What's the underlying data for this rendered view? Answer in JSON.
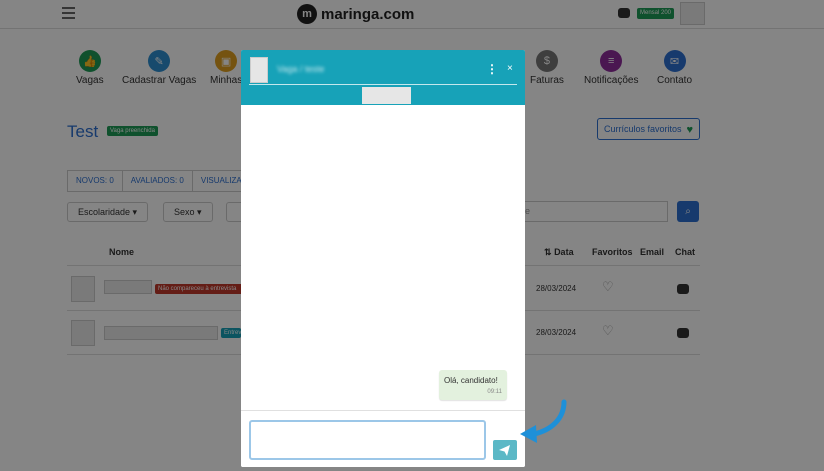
{
  "header": {
    "logo_text": "maringa.com",
    "plan_badge": "Mensal 200"
  },
  "nav": {
    "items": [
      {
        "label": "Vagas",
        "icon": "thumbs-up-icon",
        "color": "#1e9c56"
      },
      {
        "label": "Cadastrar Vagas",
        "icon": "pen-icon",
        "color": "#2c8fd1"
      },
      {
        "label": "Minhas",
        "icon": "briefcase-icon",
        "color": "#e0a020"
      },
      {
        "label": "Faturas",
        "icon": "dollar-icon",
        "color": "#777777"
      },
      {
        "label": "Notificações",
        "icon": "notes-icon",
        "color": "#8e2c9c"
      },
      {
        "label": "Contato",
        "icon": "envelope-icon",
        "color": "#2c6fd1"
      }
    ]
  },
  "page": {
    "title": "Test",
    "status_badge": "Vaga preenchida",
    "favorites_button": "Currículos favoritos"
  },
  "tabs": [
    "NOVOS: 0",
    "AVALIADOS: 0",
    "VISUALIZA"
  ],
  "filters": {
    "escolaridade": "Escolaridade ▾",
    "sexo": "Sexo ▾",
    "search_placeholder": "e"
  },
  "table": {
    "headers": {
      "name": "Nome",
      "date": "Data",
      "favorites": "Favoritos",
      "email": "Email",
      "chat": "Chat"
    },
    "rows": [
      {
        "status": "Não compareceu à entrevista",
        "status_color": "#c0392b",
        "date": "28/03/2024"
      },
      {
        "status": "Entrev",
        "status_color": "#17a2b8",
        "date": "28/03/2024"
      }
    ]
  },
  "chat": {
    "header_title": "Vaga / teste",
    "messages": [
      {
        "text": "Olá, candidato!",
        "time": "09:11"
      }
    ],
    "input_value": ""
  },
  "colors": {
    "accent": "#17a2b8",
    "brand_blue": "#2c6fd1",
    "success": "#1e9c56",
    "hint_arrow": "#1e90d8"
  }
}
